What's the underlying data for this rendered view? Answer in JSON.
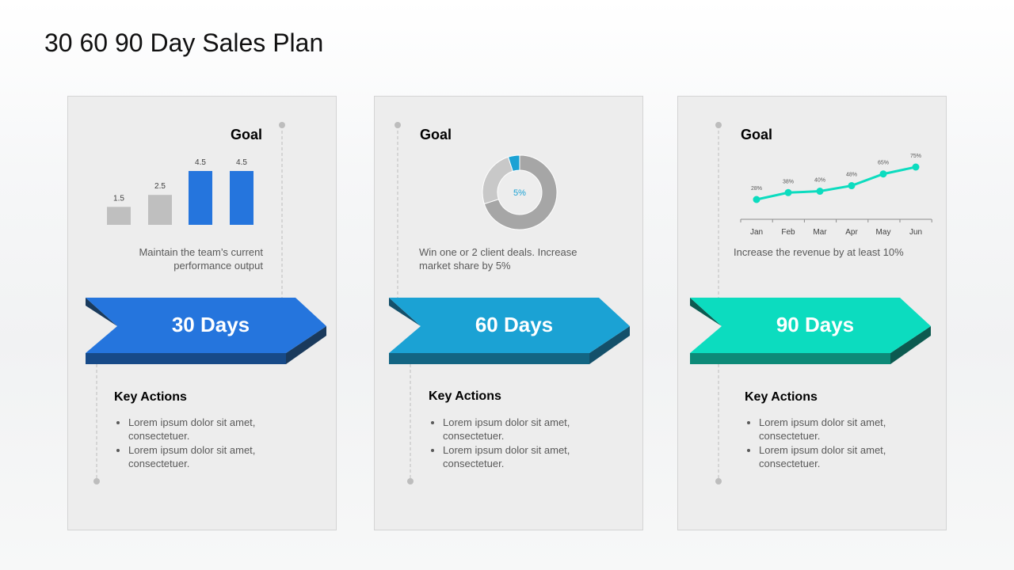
{
  "title": "30 60 90 Day Sales Plan",
  "cards": [
    {
      "label": "30 Days",
      "goal": "Goal",
      "desc": "Maintain the team’s current performance output",
      "key_actions": "Key Actions",
      "bullets": [
        "Lorem ipsum dolor sit amet, consectetuer.",
        "Lorem ipsum dolor sit amet, consectetuer."
      ],
      "color": "#2575dd",
      "dark": "#1a3a5c",
      "bottom": "#174a88"
    },
    {
      "label": "60 Days",
      "goal": "Goal",
      "desc": "Win one or 2 client deals. Increase market share by 5%",
      "key_actions": "Key Actions",
      "bullets": [
        "Lorem ipsum dolor sit amet, consectetuer.",
        "Lorem ipsum dolor sit amet, consectetuer."
      ],
      "color": "#1ba2d4",
      "dark": "#14506a",
      "bottom": "#136583"
    },
    {
      "label": "90 Days",
      "goal": "Goal",
      "desc": "Increase the revenue by at least 10%",
      "key_actions": "Key Actions",
      "bullets": [
        "Lorem ipsum dolor sit amet, consectetuer.",
        "Lorem ipsum dolor sit amet, consectetuer."
      ],
      "color": "#0cdcbf",
      "dark": "#0c5a50",
      "bottom": "#0d8a78"
    }
  ],
  "chart_data": [
    {
      "type": "bar",
      "values": [
        1.5,
        2.5,
        4.5,
        4.5
      ],
      "data_labels": [
        "1.5",
        "2.5",
        "4.5",
        "4.5"
      ],
      "colors": [
        "#bfbfbf",
        "#bfbfbf",
        "#2575dd",
        "#2575dd"
      ],
      "ylim": [
        0,
        4.5
      ]
    },
    {
      "type": "pie",
      "donut": true,
      "values": [
        70,
        25,
        5
      ],
      "colors": [
        "#a6a6a6",
        "#c8c8c8",
        "#1ba2d4"
      ],
      "center_label": "5%"
    },
    {
      "type": "line",
      "categories": [
        "Jan",
        "Feb",
        "Mar",
        "Apr",
        "May",
        "Jun"
      ],
      "values": [
        28,
        38,
        40,
        48,
        65,
        75
      ],
      "data_labels": [
        "28%",
        "38%",
        "40%",
        "48%",
        "65%",
        "75%"
      ],
      "color": "#0cdcbf",
      "ylim": [
        0,
        100
      ]
    }
  ]
}
